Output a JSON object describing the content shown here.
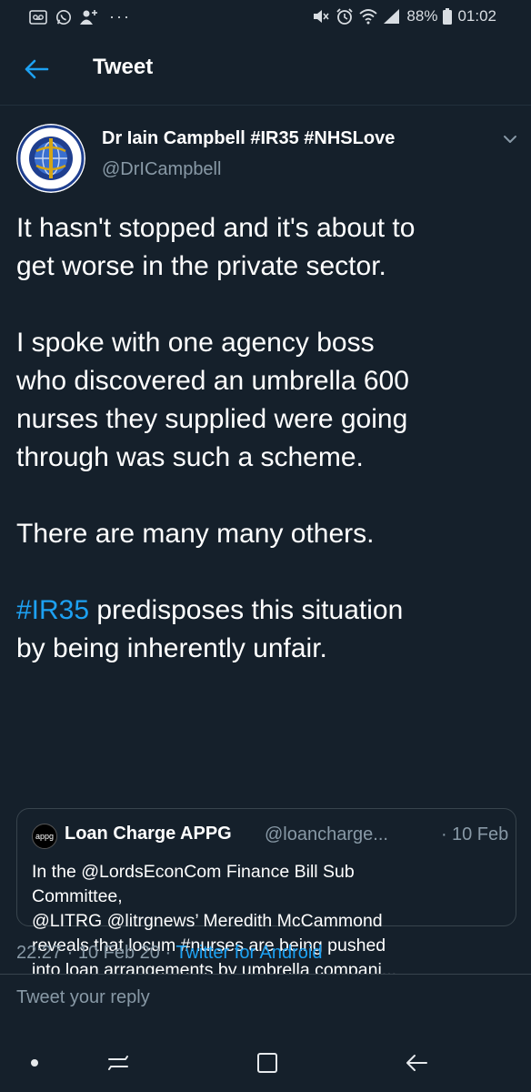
{
  "status_bar": {
    "battery": "88%",
    "time": "01:02",
    "notification_icons": [
      "voicemail-icon",
      "whatsapp-icon",
      "add-contact-icon"
    ],
    "more": "···"
  },
  "header": {
    "title": "Tweet",
    "back_icon": "back-arrow-icon"
  },
  "tweet": {
    "author_name": "Dr Iain Campbell #IR35 #NHSLove",
    "author_handle": "@DrICampbell",
    "paragraphs": [
      "It hasn't stopped and it's about to\nget worse in the private sector.",
      "I spoke with one agency boss\nwho discovered an umbrella 600\nnurses they supplied were going\nthrough was such a scheme.",
      "There are many many others."
    ],
    "last_paragraph_hashtag": "#IR35",
    "last_paragraph_rest": " predisposes this situation\nby being inherently unfair.",
    "timestamp": "22:27 · 10 Feb 20 · ",
    "source": "Twitter for Android"
  },
  "quoted_tweet": {
    "avatar_text": "appg",
    "author_name": "Loan Charge APPG",
    "author_handle": "@loancharge...",
    "separator": "·",
    "date": "10 Feb",
    "text": "In the @LordsEconCom Finance Bill Sub\nCommittee,\n@LITRG @litrgnews’ Meredith McCammond\nreveals that locum #nurses are being pushed\ninto loan arrangements by umbrella compani..."
  },
  "reply": {
    "placeholder": "Tweet your reply"
  },
  "colors": {
    "background": "#15202b",
    "accent": "#1da1f2",
    "secondary_text": "#8899a6",
    "border": "#38444d"
  }
}
